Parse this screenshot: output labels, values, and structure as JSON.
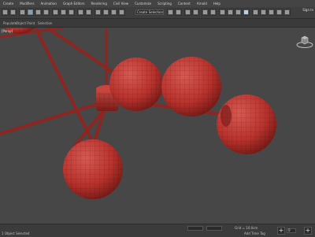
{
  "menu": [
    "Create",
    "Modifiers",
    "Animation",
    "Graph Editors",
    "Rendering",
    "Civil View",
    "Customize",
    "Scripting",
    "Content",
    "Arnold",
    "Help"
  ],
  "toolbar": {
    "selection_set_placeholder": "Create Selection Se",
    "sign_in": "Sign In"
  },
  "ribbon": {
    "items": [
      "Populate",
      "Object Paint",
      "Selection"
    ]
  },
  "viewport": {
    "label": "[Persp]",
    "background": "#474747",
    "object_color": "#b8322c"
  },
  "status": {
    "left_text": "1 Object Selected",
    "grid": "Grid = 10.0cm",
    "add_time_tag": "Add Time Tag",
    "frame": "0"
  }
}
